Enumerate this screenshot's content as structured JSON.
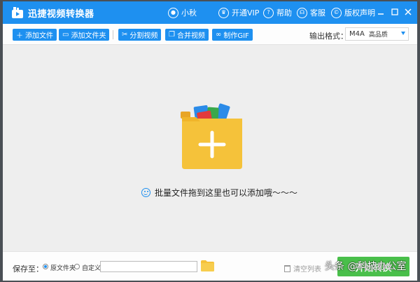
{
  "app": {
    "title": "迅捷视频转换器"
  },
  "titlebar": {
    "user_label": "小秋",
    "vip_label": "开通VIP",
    "help_label": "帮助",
    "service_label": "客服",
    "copyright_label": "版权声明"
  },
  "toolbar": {
    "add_file": "添加文件",
    "add_folder": "添加文件夹",
    "split_video": "分割视频",
    "merge_video": "合并视频",
    "make_gif": "制作GIF",
    "format_label": "输出格式：",
    "format_value": "M4A",
    "format_quality": "高品质"
  },
  "drop": {
    "hint": "批量文件拖到这里也可以添加哦～～～"
  },
  "bottom": {
    "save_label": "保存至：",
    "option_original": "原文件夹",
    "option_custom": "自定义",
    "path_value": "",
    "clear_list": "清空列表",
    "start_button": "开始转换"
  },
  "watermark": "头条 @科技办公室",
  "colors": {
    "accent": "#1e90f0",
    "start": "#49bf4a",
    "folder": "#f5c23a"
  }
}
